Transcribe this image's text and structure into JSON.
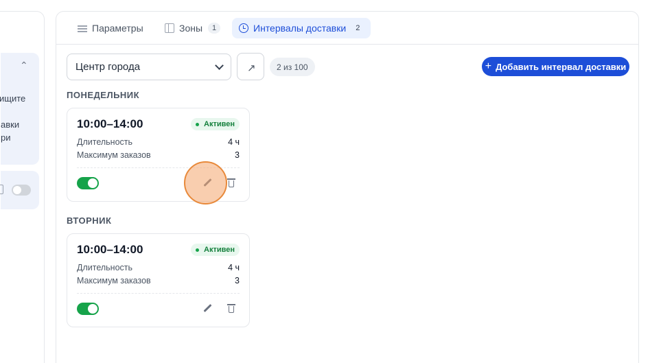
{
  "left_panel": {
    "text_lines": [
      "ищите",
      "авки",
      "ри"
    ]
  },
  "tabs": [
    {
      "label": "Параметры",
      "icon": "sliders-icon",
      "badge": null
    },
    {
      "label": "Зоны",
      "icon": "map-icon",
      "badge": "1"
    },
    {
      "label": "Интервалы доставки",
      "icon": "clock-icon",
      "badge": "2",
      "active": true
    }
  ],
  "toolbar": {
    "zone_select_value": "Центр города",
    "open_icon": "arrow-up-right-icon",
    "counter": "2 из 100",
    "add_button_label": "Добавить интервал доставки"
  },
  "days": [
    {
      "title": "ПОНЕДЕЛЬНИК",
      "interval": {
        "time": "10:00–14:00",
        "status": "Активен",
        "duration_label": "Длительность",
        "duration_value": "4 ч",
        "max_orders_label": "Максимум заказов",
        "max_orders_value": "3",
        "enabled": true
      }
    },
    {
      "title": "ВТОРНИК",
      "interval": {
        "time": "10:00–14:00",
        "status": "Активен",
        "duration_label": "Длительность",
        "duration_value": "4 ч",
        "max_orders_label": "Максимум заказов",
        "max_orders_value": "3",
        "enabled": true
      }
    }
  ],
  "colors": {
    "accent": "#1d4ed8",
    "active_tab_bg": "#eaf1fe",
    "status_green": "#16a34a",
    "status_bg": "#e8f7ee",
    "cursor_highlight": "#e8893a"
  }
}
